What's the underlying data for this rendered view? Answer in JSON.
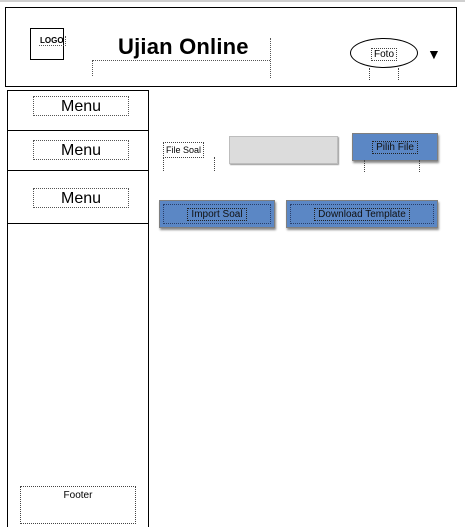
{
  "header": {
    "logo_text": "LOGO",
    "app_title": "Ujian Online",
    "profile_label": "Foto",
    "dropdown_caret": "▼"
  },
  "sidebar": {
    "items": [
      {
        "label": "Menu"
      },
      {
        "label": "Menu"
      },
      {
        "label": "Menu"
      }
    ],
    "footer": "Footer"
  },
  "main": {
    "file_label": "File Soal",
    "file_input_value": "",
    "choose_file_button": "Pilih File",
    "import_button": "Import Soal",
    "download_template_button": "Download Template"
  },
  "colors": {
    "button_blue": "#5b87c5",
    "input_gray": "#dcdcdc"
  }
}
